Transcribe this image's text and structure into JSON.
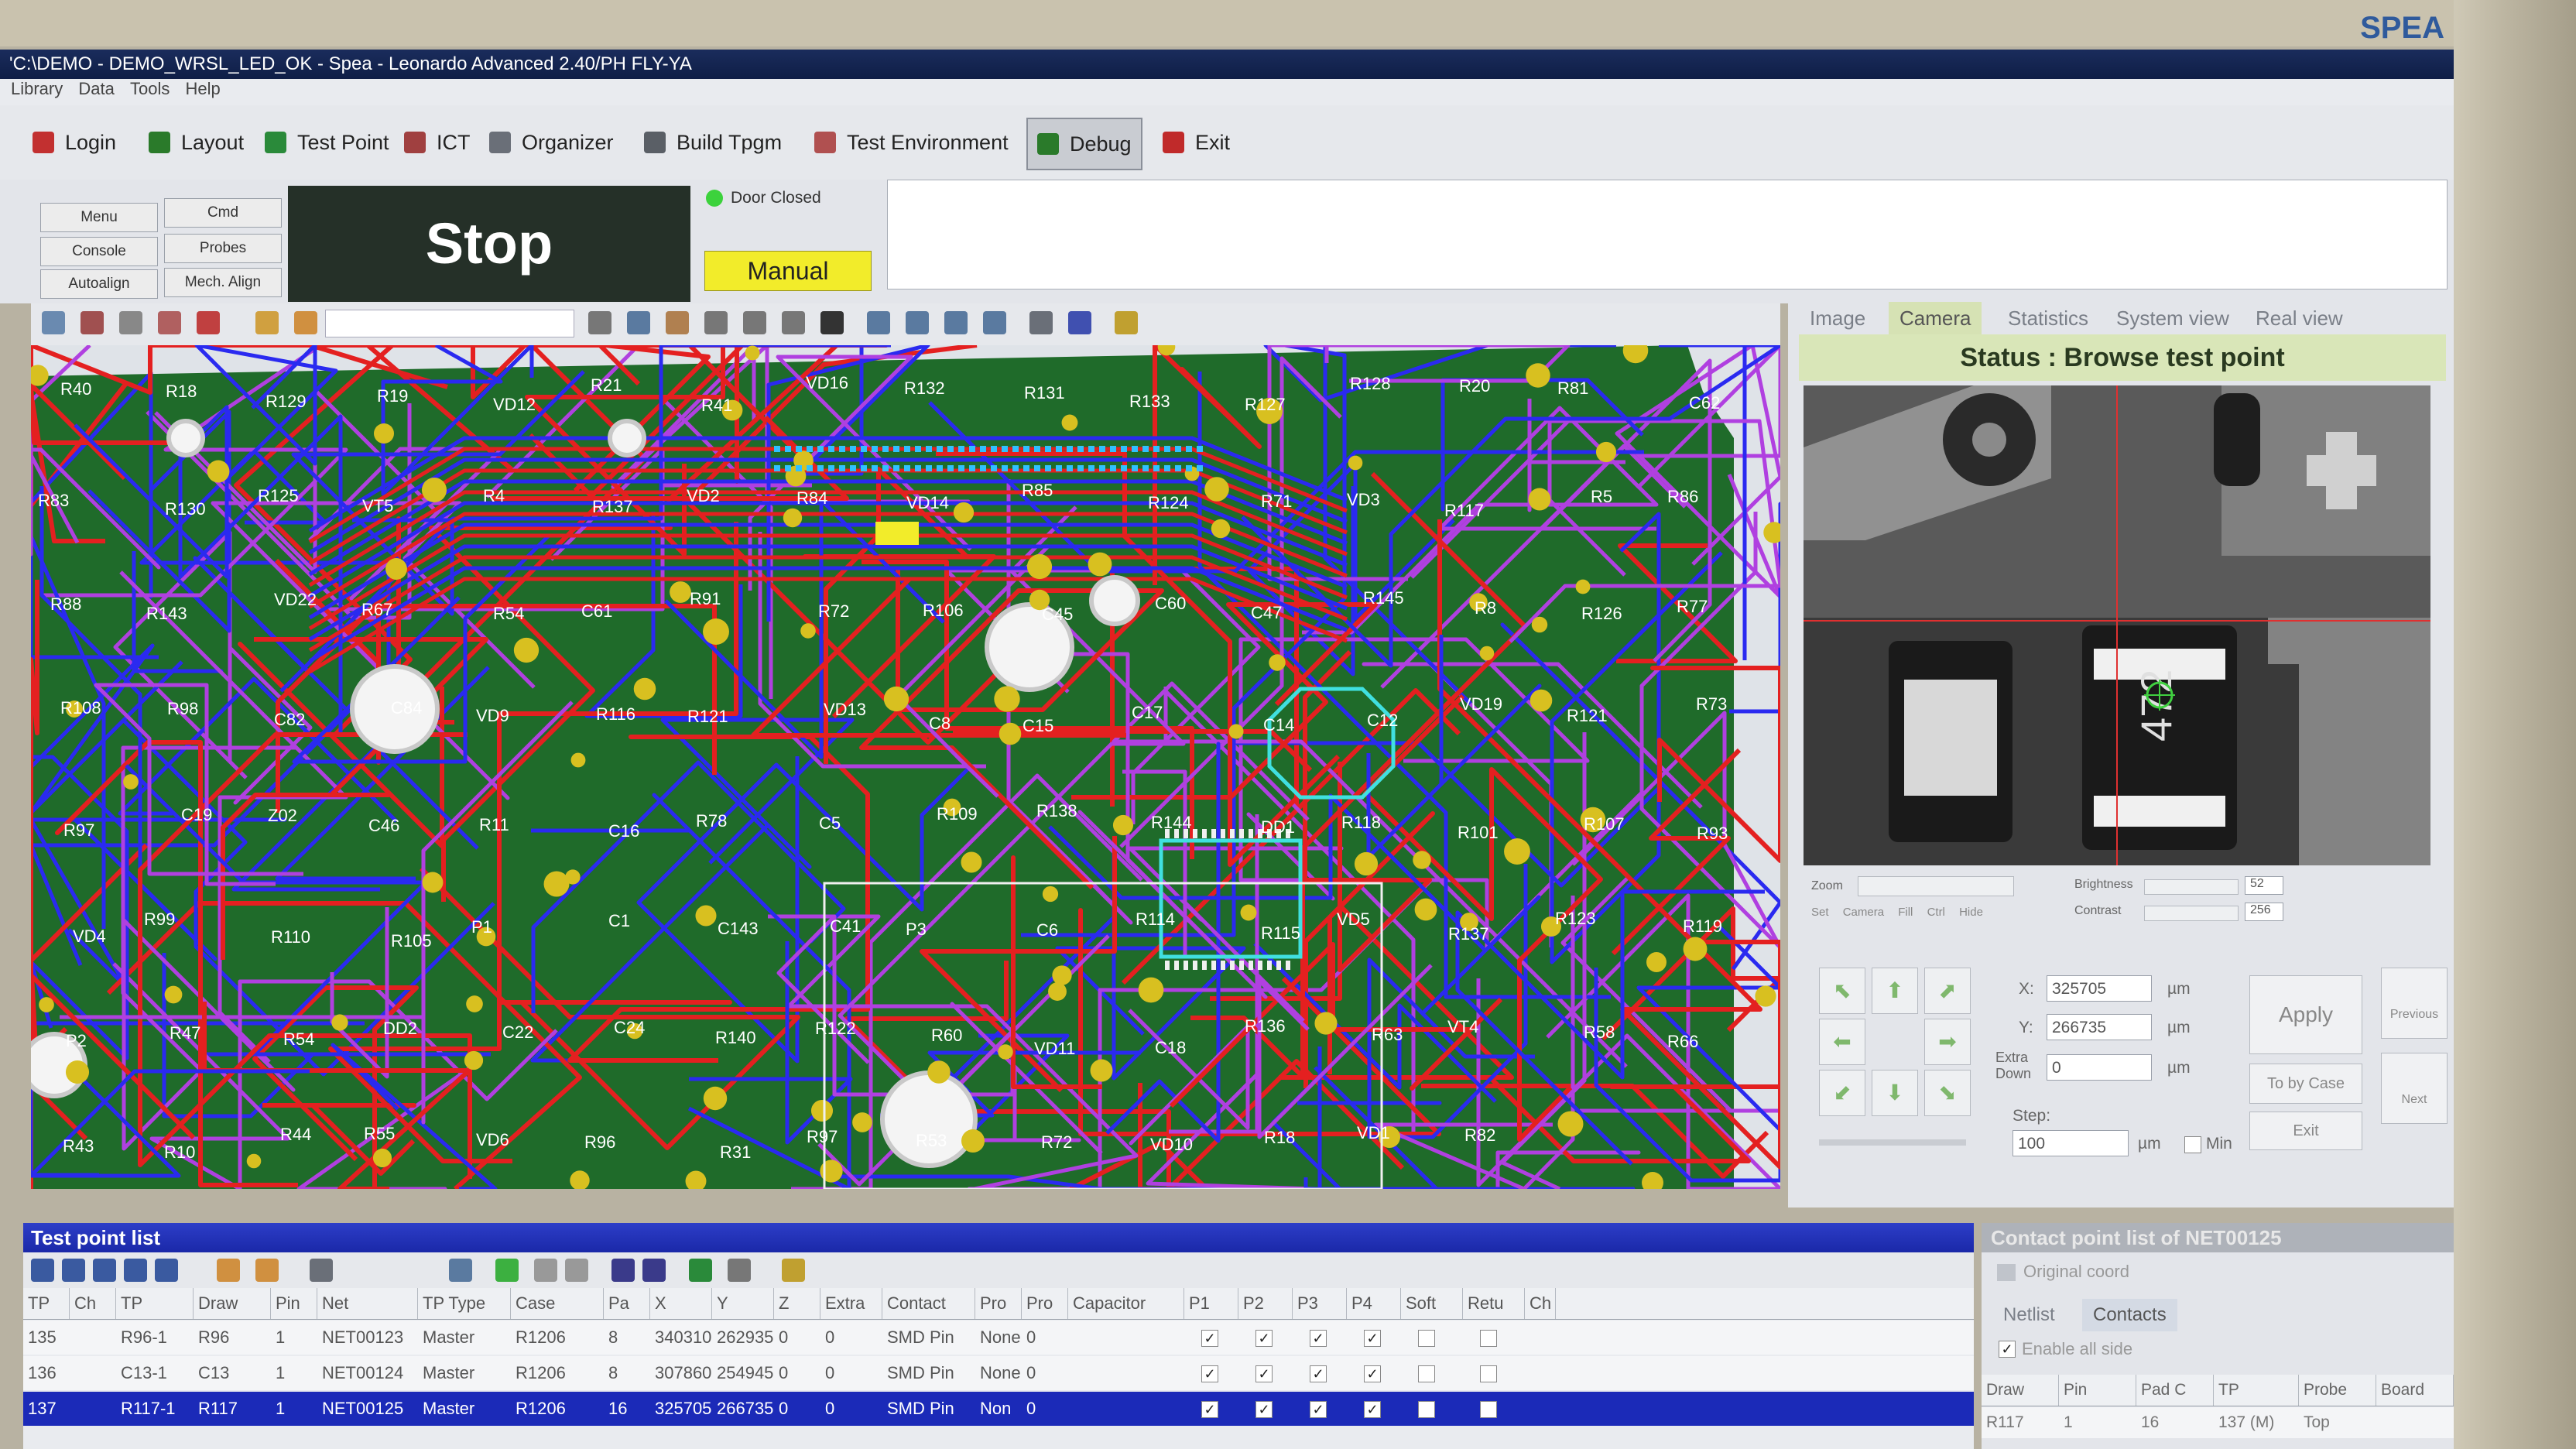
{
  "brand": {
    "logo_text": "SPEA"
  },
  "window": {
    "title": "'C:\\DEMO - DEMO_WRSL_LED_OK - Spea - Leonardo Advanced 2.40/PH FLY-YA"
  },
  "menu": [
    "Library",
    "Data",
    "Tools",
    "Help"
  ],
  "toolbar": {
    "login": "Login",
    "layout": "Layout",
    "test_point": "Test Point",
    "ict": "ICT",
    "organizer": "Organizer",
    "build_tpgm": "Build Tpgm",
    "test_environment": "Test Environment",
    "debug": "Debug",
    "exit": "Exit"
  },
  "control": {
    "menu": "Menu",
    "cmd": "Cmd",
    "console": "Console",
    "probes": "Probes",
    "autoalign": "Autoalign",
    "mech_align": "Mech. Align",
    "stop": "Stop",
    "door": "Door Closed",
    "mode": "Manual"
  },
  "board": {
    "labels": [
      "R40",
      "R18",
      "R129",
      "R19",
      "VD12",
      "R21",
      "R41",
      "VD16",
      "R132",
      "R131",
      "R133",
      "R127",
      "R128",
      "R20",
      "R81",
      "C62",
      "R83",
      "R130",
      "R125",
      "VT5",
      "R4",
      "R137",
      "VD2",
      "R84",
      "VD14",
      "R85",
      "R124",
      "R71",
      "VD3",
      "R117",
      "R5",
      "R86",
      "R88",
      "R143",
      "VD22",
      "R67",
      "R54",
      "C61",
      "R91",
      "R72",
      "R106",
      "C45",
      "C60",
      "C47",
      "R145",
      "R8",
      "R126",
      "R77",
      "R108",
      "R98",
      "C82",
      "C84",
      "VD9",
      "R116",
      "R121",
      "VD13",
      "C8",
      "C15",
      "C17",
      "C14",
      "C12",
      "VD19",
      "R121",
      "R73",
      "R97",
      "C19",
      "Z02",
      "C46",
      "R11",
      "C16",
      "R78",
      "C5",
      "R109",
      "R138",
      "R144",
      "DD1",
      "R118",
      "R101",
      "R107",
      "R93",
      "VD4",
      "R99",
      "R110",
      "R105",
      "P1",
      "C1",
      "C143",
      "C41",
      "P3",
      "C6",
      "R114",
      "R115",
      "VD5",
      "R137",
      "R123",
      "R119",
      "P2",
      "R47",
      "R54",
      "DD2",
      "C22",
      "C24",
      "R140",
      "R122",
      "R60",
      "VD11",
      "C18",
      "R136",
      "R63",
      "VT4",
      "R58",
      "R66",
      "R43",
      "R10",
      "R44",
      "R55",
      "VD6",
      "R96",
      "R31",
      "R97",
      "R53",
      "R72",
      "VD10",
      "R18",
      "VD1",
      "R82"
    ]
  },
  "right_panel": {
    "tabs": [
      "Image",
      "Camera",
      "Statistics",
      "System view",
      "Real view"
    ],
    "status": "Status : Browse test point",
    "cam_labels": {
      "zoom": "Zoom",
      "brightness": "Brightness",
      "contrast": "Contrast",
      "brightness_val": "52",
      "contrast_val": "256"
    },
    "cam_buttons": [
      "Set",
      "Camera",
      "Fill",
      "Ctrl",
      "Hide"
    ],
    "x_label": "X:",
    "x_value": "325705",
    "y_label": "Y:",
    "y_value": "266735",
    "extra_down_label": "Extra Down",
    "extra_down_value": "0",
    "unit": "µm",
    "step_label": "Step:",
    "step_value": "100",
    "min_label": "Min",
    "apply": "Apply",
    "previous": "Previous",
    "to_by_case": "To by Case",
    "next": "Next",
    "exit": "Exit"
  },
  "tp_list": {
    "title": "Test point list",
    "columns": [
      "TP",
      "Ch",
      "TP",
      "Draw",
      "Pin",
      "Net",
      "TP Type",
      "Case",
      "Pa",
      "X",
      "Y",
      "Z",
      "Extra",
      "Contact",
      "Pro",
      "Pro",
      "Capacitor",
      "P1",
      "P2",
      "P3",
      "P4",
      "Soft",
      "Retu",
      "Ch"
    ],
    "rows": [
      {
        "tp": "135",
        "tp2": "R96-1",
        "draw": "R96",
        "pin": "1",
        "net": "NET00123",
        "type": "Master",
        "case": "R1206",
        "pa": "8",
        "x": "340310",
        "y": "262935",
        "z": "0",
        "extra": "0",
        "contact": "SMD Pin",
        "pro": "None",
        "pro2": "0",
        "checks": [
          true,
          true,
          true,
          true,
          false,
          false
        ]
      },
      {
        "tp": "136",
        "tp2": "C13-1",
        "draw": "C13",
        "pin": "1",
        "net": "NET00124",
        "type": "Master",
        "case": "R1206",
        "pa": "8",
        "x": "307860",
        "y": "254945",
        "z": "0",
        "extra": "0",
        "contact": "SMD Pin",
        "pro": "None",
        "pro2": "0",
        "checks": [
          true,
          true,
          true,
          true,
          false,
          false
        ]
      },
      {
        "tp": "137",
        "tp2": "R117-1",
        "draw": "R117",
        "pin": "1",
        "net": "NET00125",
        "type": "Master",
        "case": "R1206",
        "pa": "16",
        "x": "325705",
        "y": "266735",
        "z": "0",
        "extra": "0",
        "contact": "SMD Pin",
        "pro": "Non",
        "pro2": "0",
        "checks": [
          true,
          true,
          true,
          true,
          false,
          false
        ]
      }
    ]
  },
  "cp_list": {
    "title": "Contact point list of NET00125",
    "original_coord": "Original coord",
    "tabs": [
      "Netlist",
      "Contacts"
    ],
    "enable_all": "Enable all side",
    "columns": [
      "Draw",
      "Pin",
      "Pad C",
      "TP",
      "Probe",
      "Board"
    ],
    "row": [
      "R117",
      "1",
      "16",
      "137 (M)",
      "Top",
      ""
    ]
  },
  "colors": {
    "accent": "#1b2ab8",
    "stop_bg": "#253028",
    "manual": "#f2ec2a",
    "status_bg": "#d9e6b8",
    "board_green": "#1f6b2a",
    "trace_red": "#e42020",
    "trace_blue": "#2a2af0",
    "trace_magenta": "#b040e0"
  }
}
